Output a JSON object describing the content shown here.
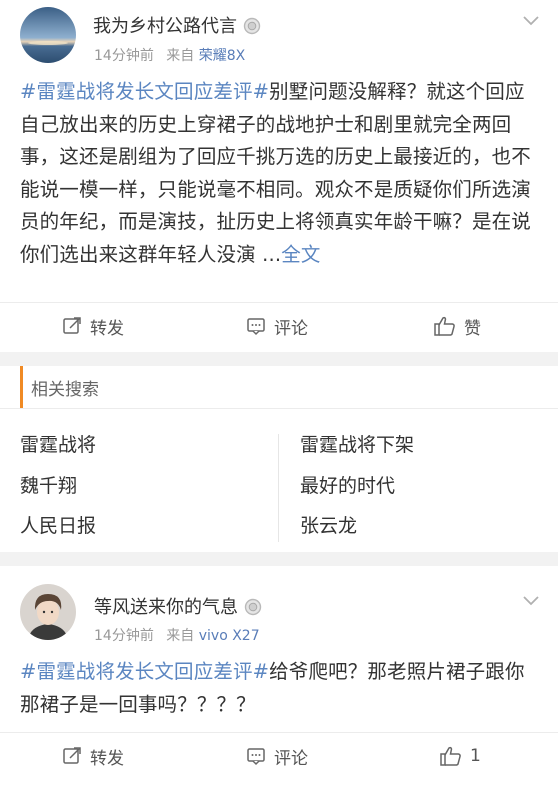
{
  "post1": {
    "username": "我为乡村公路代言",
    "time": "14分钟前",
    "source_prefix": "来自",
    "device": "荣耀8X",
    "hashtag": "#雷霆战将发长文回应差评#",
    "body": "别墅问题没解释？就这个回应自己放出来的历史上穿裙子的战地护士和剧里就完全两回事，这还是剧组为了回应千挑万选的历史上最接近的，也不能说一模一样，只能说毫不相同。观众不是质疑你们所选演员的年纪，而是演技，扯历史上将领真实年龄干嘛？是在说你们选出来这群年轻人没演 ...",
    "more": "全文",
    "actions": {
      "repost": "转发",
      "comment": "评论",
      "like": "赞"
    }
  },
  "related": {
    "title": "相关搜索",
    "items": [
      "雷霆战将",
      "雷霆战将下架",
      "魏千翔",
      "最好的时代",
      "人民日报",
      "张云龙"
    ]
  },
  "post2": {
    "username": "等风送来你的气息",
    "time": "14分钟前",
    "source_prefix": "来自",
    "device": "vivo X27",
    "hashtag": "#雷霆战将发长文回应差评#",
    "body": "给爷爬吧？那老照片裙子跟你那裙子是一回事吗？？？？",
    "actions": {
      "repost": "转发",
      "comment": "评论",
      "like": "1"
    }
  },
  "colors": {
    "link": "#5b86c1",
    "accent": "#f08a24",
    "background": "#f2f2f2"
  }
}
